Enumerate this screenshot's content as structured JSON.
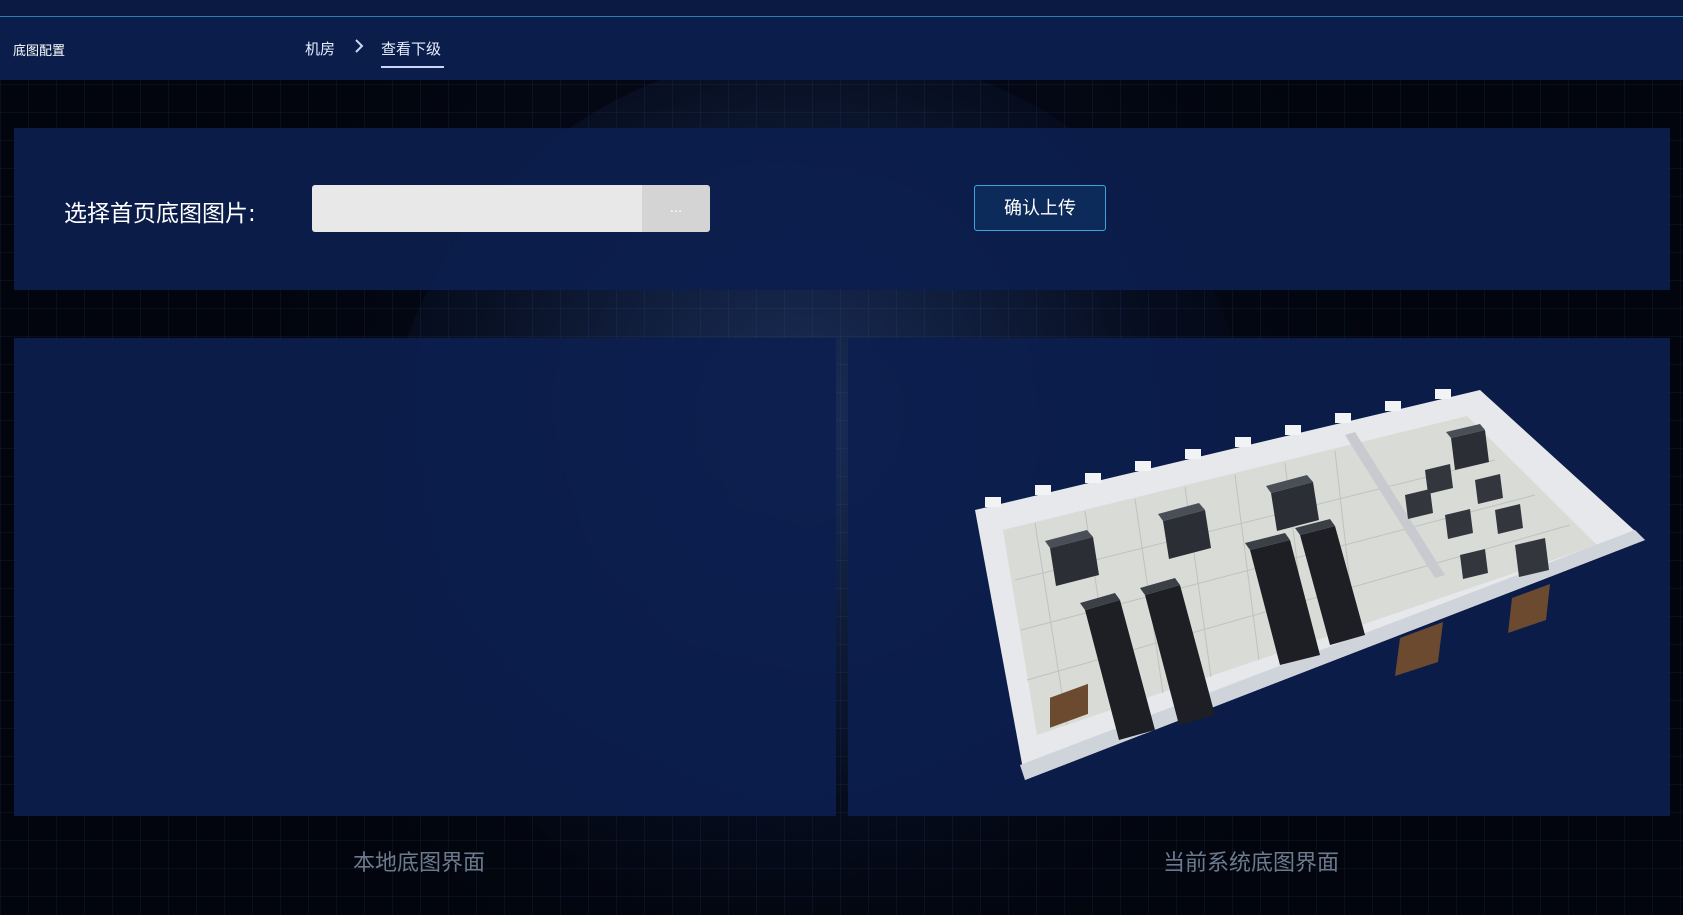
{
  "app": {
    "title": "底图配置"
  },
  "breadcrumb": {
    "items": [
      "机房",
      "查看下级"
    ],
    "active_index": 1
  },
  "upload": {
    "label": "选择首页底图图片:",
    "file_value": "",
    "browse_label": "...",
    "confirm_label": "确认上传"
  },
  "previews": {
    "local_caption": "本地底图界面",
    "system_caption": "当前系统底图界面"
  },
  "colors": {
    "panel_bg": "#0c1e4e",
    "topbar_bg": "#0b1d4a",
    "accent_border": "#3fa3d6",
    "caption_text": "#6d7a8e"
  },
  "icons": {
    "breadcrumb_separator": "chevron-right-icon"
  }
}
